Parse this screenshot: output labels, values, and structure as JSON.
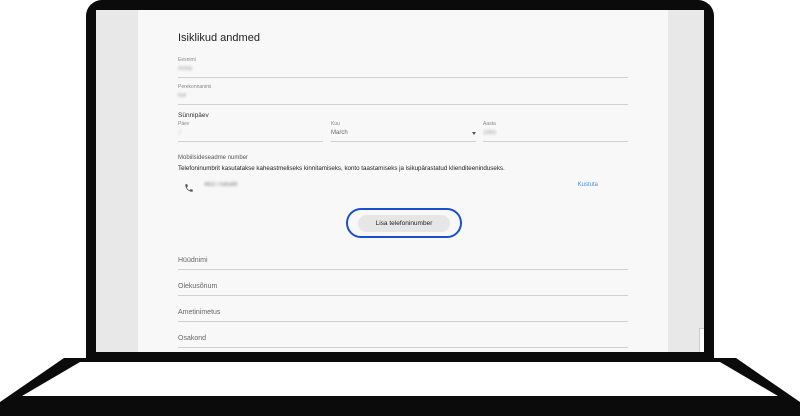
{
  "section_title": "Isiklikud andmed",
  "first_name": {
    "label": "Eesnimi",
    "value": "Anna"
  },
  "last_name": {
    "label": "Perekonnanimi",
    "value": "Kill"
  },
  "birthday": {
    "label": "Sünnipäev",
    "day": {
      "label": "Päev",
      "value": "7"
    },
    "month": {
      "label": "Kuu",
      "value": "March"
    },
    "year": {
      "label": "Aasta",
      "value": "1985"
    }
  },
  "mobile": {
    "title": "Mobiilsideseadme number",
    "description": "Telefoninumbrit kasutatakse kaheastmeliseks kinnitamiseks, konto taastamiseks ja isikupärastatud klienditeeninduseks.",
    "number": "4637756589",
    "delete_label": "Kustuta",
    "add_label": "Lisa telefoninumber"
  },
  "fields": {
    "nickname": "Hüüdnimi",
    "status": "Olekusõnum",
    "job_title": "Ametinimetus",
    "department": "Osakond"
  },
  "colors": {
    "frame": "#0b0b0b",
    "highlight_ring": "#1a4fd0",
    "link": "#4a8fe0"
  },
  "icons": {
    "phone": "phone-icon"
  }
}
